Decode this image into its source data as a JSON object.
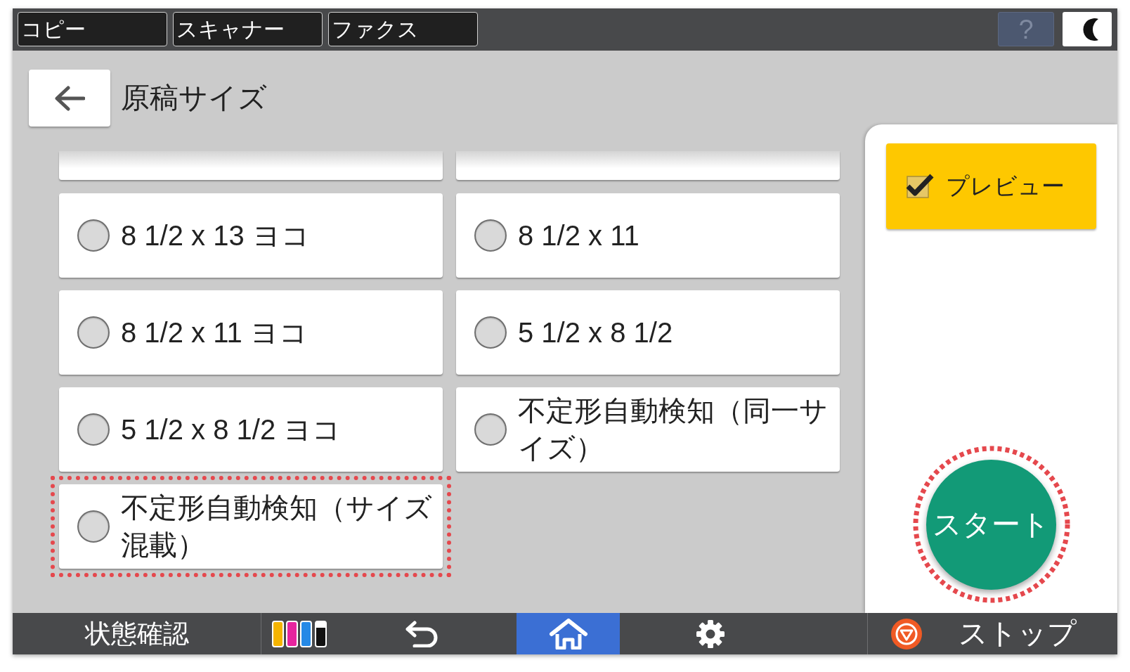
{
  "top_bar": {
    "mode_tabs": [
      {
        "label": "コピー",
        "selected": false
      },
      {
        "label": "スキャナー",
        "selected": false
      },
      {
        "label": "ファクス",
        "selected": false
      }
    ],
    "help_button": {
      "label": "?",
      "disabled": true
    }
  },
  "header": {
    "title": "原稿サイズ"
  },
  "options": [
    {
      "label": "8 1/2 x 13 ヨコ",
      "selected": false,
      "highlighted": false
    },
    {
      "label": "8 1/2 x 11 ヨコ",
      "selected": false,
      "highlighted": false
    },
    {
      "label": "5 1/2 x 8 1/2 ヨコ",
      "selected": false,
      "highlighted": false
    },
    {
      "label": "不定形自動検知（サイズ混載）",
      "selected": false,
      "highlighted": true
    },
    {
      "label": "8 1/2 x 11",
      "selected": false,
      "highlighted": false
    },
    {
      "label": "5 1/2 x 8 1/2",
      "selected": false,
      "highlighted": false
    },
    {
      "label": "不定形自動検知（同一サイズ）",
      "selected": false,
      "highlighted": false
    }
  ],
  "side_panel": {
    "preview": {
      "label": "プレビュー",
      "checked": true
    },
    "start_button": {
      "label": "スタート",
      "highlighted": true
    }
  },
  "bottom_bar": {
    "status_button": {
      "label": "状態確認"
    },
    "nav_buttons": [
      {
        "kind": "ink",
        "selected": false
      },
      {
        "kind": "back",
        "selected": false
      },
      {
        "kind": "home",
        "selected": true
      },
      {
        "kind": "settings",
        "selected": false
      }
    ],
    "stop_button": {
      "label": "ストップ"
    }
  }
}
